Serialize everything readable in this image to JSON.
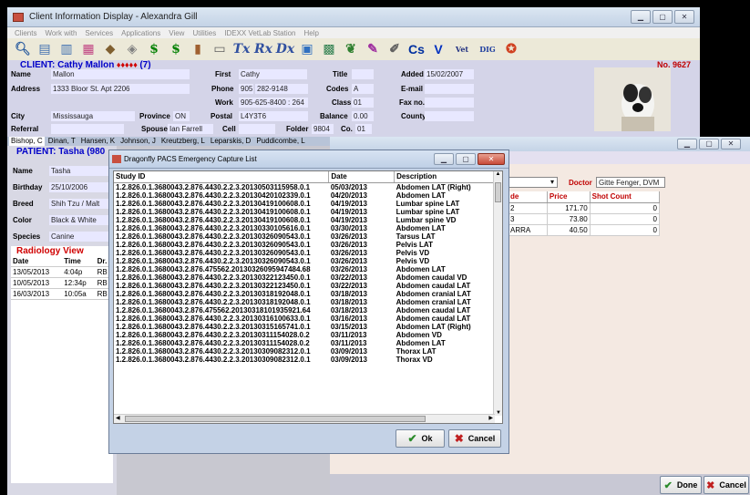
{
  "main_window": {
    "title": "Client Information Display - Alexandra Gill",
    "menu": [
      "Clients",
      "Work with",
      "Services",
      "Applications",
      "View",
      "Utilities",
      "IDEXX VetLab Station",
      "Help"
    ]
  },
  "client": {
    "header": "CLIENT: Cathy Mallon",
    "stars": "♦♦♦♦♦",
    "count": "(7)",
    "number": "No. 9627",
    "name_label": "Name",
    "name": "Mallon",
    "address_label": "Address",
    "address": "1333 Bloor St. Apt 2206",
    "city_label": "City",
    "city": "Mississauga",
    "province_label": "Province",
    "province": "ON",
    "referral_label": "Referral",
    "spouse_label": "Spouse",
    "spouse": "Ian Farrell",
    "first_label": "First",
    "first": "Cathy",
    "phone_label": "Phone",
    "phone_area": "905",
    "phone": "282-9148",
    "work_label": "Work",
    "work": "905-625-8400 : 264",
    "postal_label": "Postal",
    "postal": "L4Y3T6",
    "cell_label": "Cell",
    "folder_label": "Folder",
    "folder": "9804",
    "co_label": "Co.",
    "co": "01",
    "title_label": "Title",
    "codes_label": "Codes",
    "codes": "A",
    "class_label": "Class",
    "class": "01",
    "balance_label": "Balance",
    "balance": "0.00",
    "added_label": "Added",
    "added": "15/02/2007",
    "email_label": "E-mail",
    "fax_label": "Fax no.",
    "county_label": "County"
  },
  "tabs": [
    "Bishop, C",
    "Dinan, T",
    "Hansen, K",
    "Johnson, J",
    "Kreutzberg, L",
    "Leparskis, D",
    "Puddicombe, L"
  ],
  "patient": {
    "header": "PATIENT: Tasha (980",
    "name_label": "Name",
    "name": "Tasha",
    "birthday_label": "Birthday",
    "birthday": "25/10/2006",
    "breed_label": "Breed",
    "breed": "Shih Tzu / Malt",
    "color_label": "Color",
    "color": "Black & White",
    "species_label": "Species",
    "species": "Canine"
  },
  "radiology": {
    "title": "Radiology View",
    "headers": [
      "Date",
      "Time",
      "Dr."
    ],
    "rows": [
      [
        "13/05/2013",
        "4:04p",
        "RB"
      ],
      [
        "10/05/2013",
        "12:34p",
        "RB"
      ],
      [
        "16/03/2013",
        "10:05a",
        "RB"
      ]
    ]
  },
  "right_panel": {
    "doctor_label": "Doctor",
    "doctor": "Gitte Fenger, DVM",
    "headers": [
      "de",
      "Price",
      "Shot Count"
    ],
    "rows": [
      [
        "2",
        "171.70",
        "0"
      ],
      [
        "3",
        "73.80",
        "0"
      ],
      [
        "ARRA",
        "40.50",
        "0"
      ]
    ],
    "done": "Done",
    "cancel": "Cancel"
  },
  "dialog": {
    "title": "Dragonfly PACS Emergency Capture List",
    "headers": [
      "Study ID",
      "Date",
      "Description"
    ],
    "rows": [
      [
        "1.2.826.0.1.3680043.2.876.4430.2.2.3.20130503115958.0.1",
        "05/03/2013",
        "Abdomen LAT (Right)"
      ],
      [
        "1.2.826.0.1.3680043.2.876.4430.2.2.3.20130420102339.0.1",
        "04/20/2013",
        "Abdomen LAT"
      ],
      [
        "1.2.826.0.1.3680043.2.876.4430.2.2.3.20130419100608.0.1",
        "04/19/2013",
        "Lumbar spine LAT"
      ],
      [
        "1.2.826.0.1.3680043.2.876.4430.2.2.3.20130419100608.0.1",
        "04/19/2013",
        "Lumbar spine LAT"
      ],
      [
        "1.2.826.0.1.3680043.2.876.4430.2.2.3.20130419100608.0.1",
        "04/19/2013",
        "Lumbar spine VD"
      ],
      [
        "1.2.826.0.1.3680043.2.876.4430.2.2.3.20130330105616.0.1",
        "03/30/2013",
        "Abdomen LAT"
      ],
      [
        "1.2.826.0.1.3680043.2.876.4430.2.2.3.20130326090543.0.1",
        "03/26/2013",
        "Tarsus LAT"
      ],
      [
        "1.2.826.0.1.3680043.2.876.4430.2.2.3.20130326090543.0.1",
        "03/26/2013",
        "Pelvis LAT"
      ],
      [
        "1.2.826.0.1.3680043.2.876.4430.2.2.3.20130326090543.0.1",
        "03/26/2013",
        "Pelvis VD"
      ],
      [
        "1.2.826.0.1.3680043.2.876.4430.2.2.3.20130326090543.0.1",
        "03/26/2013",
        "Pelvis VD"
      ],
      [
        "1.2.826.0.1.3680043.2.876.475562.20130326095947484.68",
        "03/26/2013",
        "Abdomen LAT"
      ],
      [
        "1.2.826.0.1.3680043.2.876.4430.2.2.3.20130322123450.0.1",
        "03/22/2013",
        "Abdomen caudal VD"
      ],
      [
        "1.2.826.0.1.3680043.2.876.4430.2.2.3.20130322123450.0.1",
        "03/22/2013",
        "Abdomen caudal LAT"
      ],
      [
        "1.2.826.0.1.3680043.2.876.4430.2.2.3.20130318192048.0.1",
        "03/18/2013",
        "Abdomen cranial LAT"
      ],
      [
        "1.2.826.0.1.3680043.2.876.4430.2.2.3.20130318192048.0.1",
        "03/18/2013",
        "Abdomen cranial LAT"
      ],
      [
        "1.2.826.0.1.3680043.2.876.475562.20130318101935921.64",
        "03/18/2013",
        "Abdomen caudal LAT"
      ],
      [
        "1.2.826.0.1.3680043.2.876.4430.2.2.3.20130316100633.0.1",
        "03/16/2013",
        "Abdomen caudal LAT"
      ],
      [
        "1.2.826.0.1.3680043.2.876.4430.2.2.3.20130315165741.0.1",
        "03/15/2013",
        "Abdomen LAT (Right)"
      ],
      [
        "1.2.826.0.1.3680043.2.876.4430.2.2.3.20130311154028.0.2",
        "03/11/2013",
        "Abdomen VD"
      ],
      [
        "1.2.826.0.1.3680043.2.876.4430.2.2.3.20130311154028.0.2",
        "03/11/2013",
        "Abdomen LAT"
      ],
      [
        "1.2.826.0.1.3680043.2.876.4430.2.2.3.20130309082312.0.1",
        "03/09/2013",
        "Thorax LAT"
      ],
      [
        "1.2.826.0.1.3680043.2.876.4430.2.2.3.20130309082312.0.1",
        "03/09/2013",
        "Thorax VD"
      ]
    ],
    "ok": "Ok",
    "cancel": "Cancel"
  },
  "colors": {
    "accent": "#0000c8",
    "field_bg": "#e8e8ff",
    "close_red": "#c84a38"
  }
}
